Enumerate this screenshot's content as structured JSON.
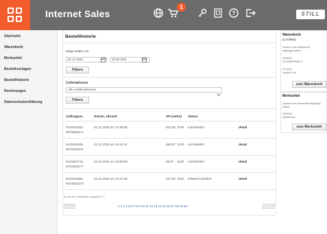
{
  "header": {
    "app_title": "Internet Sales",
    "cart_badge": "1",
    "brand": "STILL",
    "icons": [
      "grid-icon",
      "globe-icon",
      "cart-icon",
      "key-icon",
      "contact-card-icon",
      "help-icon",
      "logout-icon"
    ]
  },
  "sidebar": {
    "items": [
      {
        "label": "Startseite"
      },
      {
        "label": "Warenkorb"
      },
      {
        "label": "Merkzettel"
      },
      {
        "label": "Bestellvorlagen"
      },
      {
        "label": "Bestellhistorie"
      },
      {
        "label": "Rechnungen"
      },
      {
        "label": "Datenschutzerklärung"
      }
    ]
  },
  "main": {
    "title": "Bestellhistorie",
    "date_filter": {
      "label": "Zeige Daten von",
      "from": "01.12.2020",
      "separator": "-",
      "to": "06.06.2021",
      "button": "Filtern"
    },
    "address_filter": {
      "label": "Lieferadresse",
      "selected": "Alle Anlieferadressen",
      "button": "Filtern"
    },
    "table": {
      "headers": [
        "Auftragsnr.",
        "Datum, Uhrzeit",
        "GP (netto)",
        "Status",
        ""
      ],
      "rows": [
        {
          "order": "0140404352",
          "ref": "Ref:8526271",
          "date": "01.12.2020 um 13:38:06",
          "amount": "612,08",
          "currency": "EUR",
          "status": "voll beliefert",
          "action": "detail"
        },
        {
          "order": "0140404635",
          "ref": "Ref:8526272",
          "date": "01.12.2020 um 15:42:41",
          "amount": "590,97",
          "currency": "EUR",
          "status": "voll beliefert",
          "action": "detail"
        },
        {
          "order": "0140404715",
          "ref": "Ref:8526277",
          "date": "02.12.2020 um 16:59:00",
          "amount": "95,67",
          "currency": "EUR",
          "status": "voll beliefert",
          "action": "detail"
        },
        {
          "order": "0140404882",
          "ref": "Ref:8526273",
          "date": "03.12.2020 um 10:21:38",
          "amount": "427,08",
          "currency": "EUR",
          "status": "teilweise beliefert",
          "action": "detail"
        }
      ]
    },
    "total_note": "Anzahl der Datensätze insgesamt: 77",
    "pager": {
      "prev": "<",
      "next": ">",
      "pages": "1  2  3  4  5  6  7  8  9  10  11  12  13  14  15  16  17  18  19  20"
    }
  },
  "warenkorb": {
    "title": "Warenkorb",
    "subtitle": "(1 Artikel)",
    "info": [
      "Zuletzt in den Warenkorb",
      "abgelegte Artikel:"
    ],
    "item1": [
      "0000005",
      "SCHEIBENRAD 6"
    ],
    "item2": [
      "0712042",
      "Joystick 3ok"
    ],
    "button": "zum Warenkorb"
  },
  "merkzettel": {
    "title": "Merkzettel",
    "info": [
      "Zuletzt in den Merkzettel abgelegte",
      "Artikel:"
    ],
    "item1": [
      "0000004",
      "Kabelbinder"
    ],
    "button": "zum Merkzettel"
  }
}
